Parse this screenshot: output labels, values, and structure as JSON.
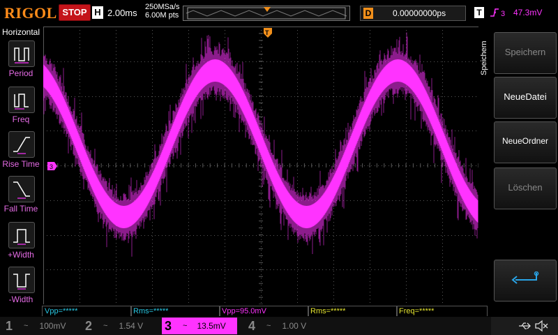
{
  "header": {
    "brand": "RIGOL",
    "run_state": "STOP",
    "timebase_letter": "H",
    "timebase": "2.00ms",
    "sample_rate": "250MSa/s",
    "memory_depth": "6.00M pts",
    "delay_letter": "D",
    "delay_value": "0.00000000ps",
    "trigger_letter": "T",
    "trigger_level": "47.3mV"
  },
  "left_menu": {
    "title": "Horizontal",
    "items": [
      {
        "label": "Period"
      },
      {
        "label": "Freq"
      },
      {
        "label": "Rise Time"
      },
      {
        "label": "Fall Time"
      },
      {
        "label": "+Width"
      },
      {
        "label": "-Width"
      }
    ]
  },
  "right_menu": {
    "vertical_title": "Speichern",
    "buttons": [
      {
        "label": "Speichern",
        "enabled": false
      },
      {
        "label": "NeueDatei",
        "enabled": true
      },
      {
        "label": "NeueOrdner",
        "enabled": true
      },
      {
        "label": "Löschen",
        "enabled": false
      }
    ]
  },
  "measurements": [
    {
      "text": "Vpp=*****",
      "color": "#29c9e5"
    },
    {
      "text": "Rms=*****",
      "color": "#29c9e5"
    },
    {
      "text": "Vpp=95.0mV",
      "color": "#ff33ff"
    },
    {
      "text": "Rms=*****",
      "color": "#e6e630"
    },
    {
      "text": "Freq=*****",
      "color": "#e6e630"
    }
  ],
  "channels": [
    {
      "num": "1",
      "value": "100mV",
      "color": "#8a8a8a",
      "active": false
    },
    {
      "num": "2",
      "value": "1.54 V",
      "color": "#8a8a8a",
      "active": false
    },
    {
      "num": "3",
      "value": "13.5mV",
      "color": "#ff33ff",
      "active": true
    },
    {
      "num": "4",
      "value": "1.00 V",
      "color": "#8a8a8a",
      "active": false
    }
  ],
  "colors": {
    "trace": "#ff33ff",
    "grid": "#5a5a5a",
    "accent_orange": "#f18f1b",
    "stop_red": "#c4141a"
  },
  "icons": [
    "period-icon",
    "freq-icon",
    "rise-time-icon",
    "fall-time-icon",
    "pos-width-icon",
    "neg-width-icon",
    "enter-return-icon",
    "usb-icon",
    "speaker-mute-icon"
  ]
}
